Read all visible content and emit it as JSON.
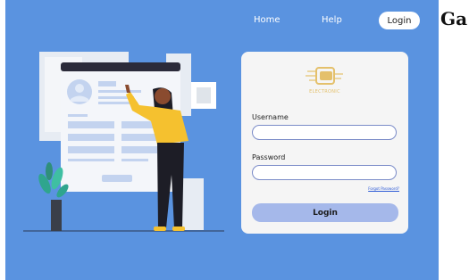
{
  "nav": {
    "home": "Home",
    "help": "Help",
    "login": "Login"
  },
  "brand_fragment": "Ga",
  "login_card": {
    "logo_text": "ELECTRONIC",
    "username_label": "Username",
    "username_value": "",
    "password_label": "Password",
    "password_value": "",
    "forgot_link": "Forgot Password?",
    "submit_label": "Login"
  },
  "colors": {
    "background": "#5a93e0",
    "card": "#f5f5f5",
    "button": "#a5b8ea",
    "logo": "#e4c06b",
    "link": "#2e5bd6"
  },
  "icons": [
    "electronic-logo-icon",
    "avatar-icon",
    "plant-icon"
  ]
}
